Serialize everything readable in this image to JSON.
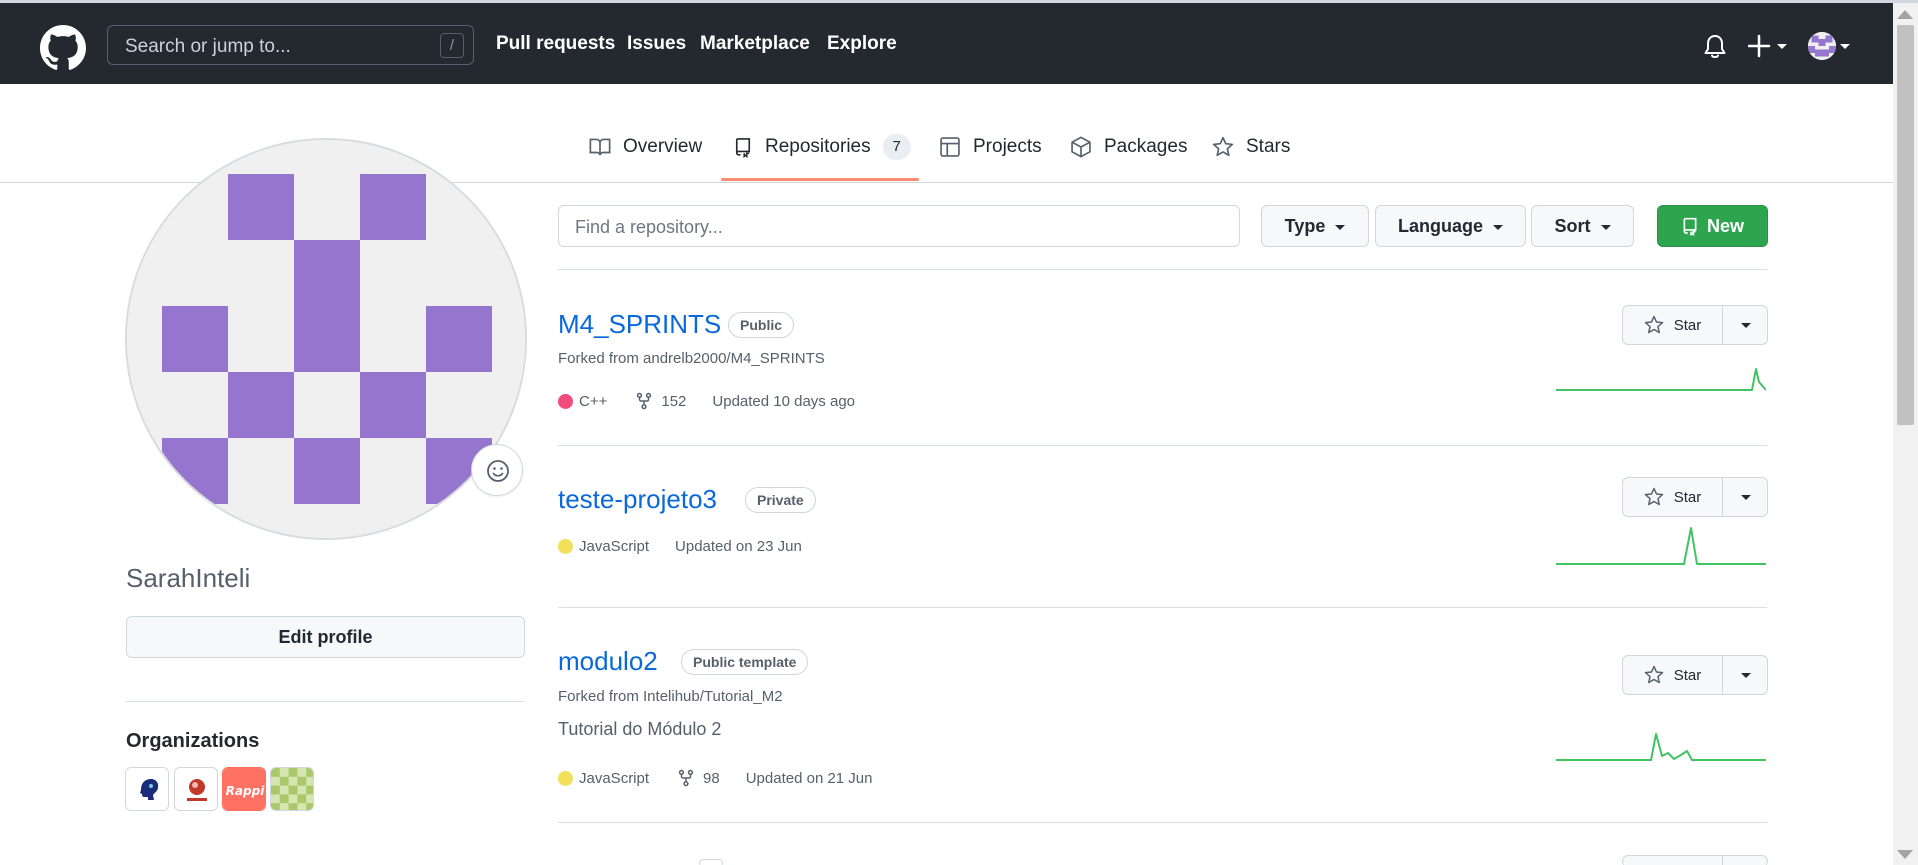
{
  "header": {
    "search_placeholder": "Search or jump to...",
    "search_shortcut": "/",
    "nav": [
      "Pull requests",
      "Issues",
      "Marketplace",
      "Explore"
    ]
  },
  "tabs": [
    {
      "label": "Overview",
      "icon": "book-icon"
    },
    {
      "label": "Repositories",
      "icon": "repo-icon",
      "count": "7",
      "selected": true
    },
    {
      "label": "Projects",
      "icon": "table-icon"
    },
    {
      "label": "Packages",
      "icon": "package-icon"
    },
    {
      "label": "Stars",
      "icon": "star-icon"
    }
  ],
  "profile": {
    "username": "SarahInteli",
    "edit_label": "Edit profile",
    "orgs_title": "Organizations",
    "avatar_color": "#9575cd"
  },
  "filters": {
    "search_placeholder": "Find a repository...",
    "type_label": "Type",
    "language_label": "Language",
    "sort_label": "Sort",
    "new_label": "New"
  },
  "repos": [
    {
      "name": "M4_SPRINTS",
      "badge": "Public",
      "forked_from": "Forked from andrelb2000/M4_SPRINTS",
      "language": "C++",
      "language_color": "#f34b7d",
      "forks": "152",
      "updated": "Updated 10 days ago",
      "star_label": "Star"
    },
    {
      "name": "teste-projeto3",
      "badge": "Private",
      "language": "JavaScript",
      "language_color": "#f1e05a",
      "updated": "Updated on 23 Jun",
      "star_label": "Star"
    },
    {
      "name": "modulo2",
      "badge": "Public template",
      "forked_from": "Forked from Intelihub/Tutorial_M2",
      "description": "Tutorial do Módulo 2",
      "language": "JavaScript",
      "language_color": "#f1e05a",
      "forks": "98",
      "updated": "Updated on 21 Jun",
      "star_label": "Star"
    }
  ],
  "colors": {
    "header_bg": "#24292f",
    "link": "#0969da",
    "new_button": "#2da44e",
    "tab_underline": "#fd8c73"
  }
}
